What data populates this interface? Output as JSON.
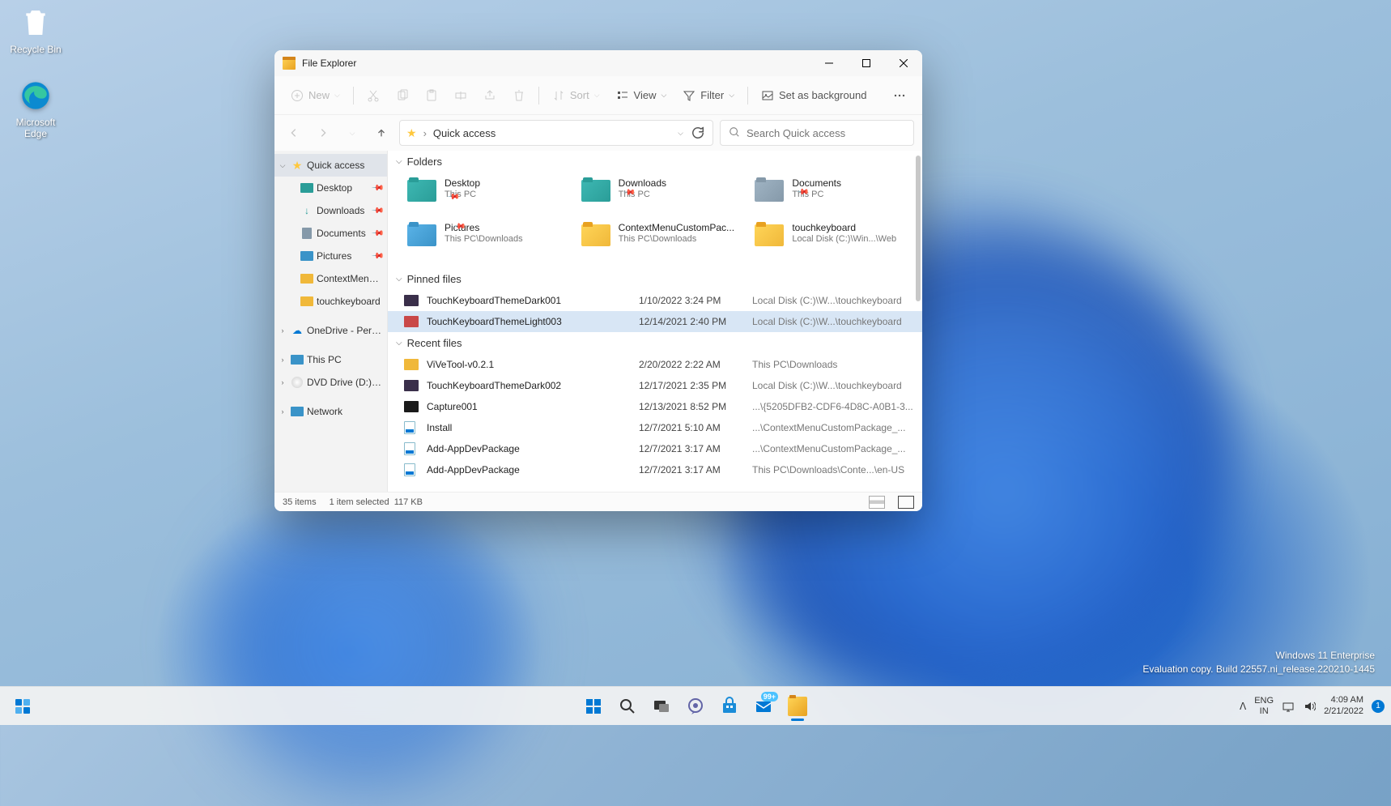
{
  "desktop": {
    "icons": [
      {
        "label": "Recycle Bin"
      },
      {
        "label": "Microsoft Edge"
      }
    ]
  },
  "watermark": {
    "line1": "Windows 11 Enterprise",
    "line2": "Evaluation copy. Build 22557.ni_release.220210-1445"
  },
  "window": {
    "title": "File Explorer",
    "toolbar": {
      "new": "New",
      "sort": "Sort",
      "view": "View",
      "filter": "Filter",
      "set_bg": "Set as background"
    },
    "address": {
      "crumb": "Quick access"
    },
    "search": {
      "placeholder": "Search Quick access"
    },
    "sidebar": {
      "items": [
        {
          "label": "Quick access",
          "selected": true,
          "expandable": true,
          "icon": "star"
        },
        {
          "label": "Desktop",
          "pinned": true,
          "sub": true,
          "icon": "desktop"
        },
        {
          "label": "Downloads",
          "pinned": true,
          "sub": true,
          "icon": "download"
        },
        {
          "label": "Documents",
          "pinned": true,
          "sub": true,
          "icon": "document"
        },
        {
          "label": "Pictures",
          "pinned": true,
          "sub": true,
          "icon": "pictures"
        },
        {
          "label": "ContextMenuCust",
          "sub": true,
          "icon": "folder"
        },
        {
          "label": "touchkeyboard",
          "sub": true,
          "icon": "folder"
        },
        {
          "label": "OneDrive - Personal",
          "expandable": true,
          "icon": "onedrive"
        },
        {
          "label": "This PC",
          "expandable": true,
          "icon": "pc"
        },
        {
          "label": "DVD Drive (D:) CCCO",
          "expandable": true,
          "icon": "dvd"
        },
        {
          "label": "Network",
          "expandable": true,
          "icon": "network"
        }
      ]
    },
    "sections": {
      "folders": "Folders",
      "pinned": "Pinned files",
      "recent": "Recent files"
    },
    "folders": [
      {
        "name": "Desktop",
        "loc": "This PC",
        "pinned": true,
        "color": "teal"
      },
      {
        "name": "Downloads",
        "loc": "This PC",
        "pinned": true,
        "color": "teal"
      },
      {
        "name": "Documents",
        "loc": "This PC",
        "pinned": true,
        "color": "gray"
      },
      {
        "name": "Pictures",
        "loc": "This PC\\Downloads",
        "pinned": true,
        "color": "blue"
      },
      {
        "name": "ContextMenuCustomPac...",
        "loc": "This PC\\Downloads",
        "color": "yellow"
      },
      {
        "name": "touchkeyboard",
        "loc": "Local Disk (C:)\\Win...\\Web",
        "color": "yellow"
      }
    ],
    "pinned_files": [
      {
        "name": "TouchKeyboardThemeDark001",
        "date": "1/10/2022 3:24 PM",
        "path": "Local Disk (C:)\\W...\\touchkeyboard",
        "thumb": "#3a2f4a"
      },
      {
        "name": "TouchKeyboardThemeLight003",
        "date": "12/14/2021 2:40 PM",
        "path": "Local Disk (C:)\\W...\\touchkeyboard",
        "thumb": "#c94848",
        "selected": true
      }
    ],
    "recent_files": [
      {
        "name": "ViVeTool-v0.2.1",
        "date": "2/20/2022 2:22 AM",
        "path": "This PC\\Downloads",
        "thumb": "folder"
      },
      {
        "name": "TouchKeyboardThemeDark002",
        "date": "12/17/2021 2:35 PM",
        "path": "Local Disk (C:)\\W...\\touchkeyboard",
        "thumb": "#3a2f4a"
      },
      {
        "name": "Capture001",
        "date": "12/13/2021 8:52 PM",
        "path": "...\\{5205DFB2-CDF6-4D8C-A0B1-3...",
        "thumb": "#1a1a1a"
      },
      {
        "name": "Install",
        "date": "12/7/2021 5:10 AM",
        "path": "...\\ContextMenuCustomPackage_...",
        "thumb": "script"
      },
      {
        "name": "Add-AppDevPackage",
        "date": "12/7/2021 3:17 AM",
        "path": "...\\ContextMenuCustomPackage_...",
        "thumb": "script"
      },
      {
        "name": "Add-AppDevPackage",
        "date": "12/7/2021 3:17 AM",
        "path": "This PC\\Downloads\\Conte...\\en-US",
        "thumb": "script"
      }
    ],
    "status": {
      "count": "35 items",
      "selection": "1 item selected",
      "size": "117 KB"
    }
  },
  "taskbar": {
    "lang1": "ENG",
    "lang2": "IN",
    "time": "4:09 AM",
    "date": "2/21/2022",
    "notif_count": "1",
    "mail_badge": "99+"
  }
}
